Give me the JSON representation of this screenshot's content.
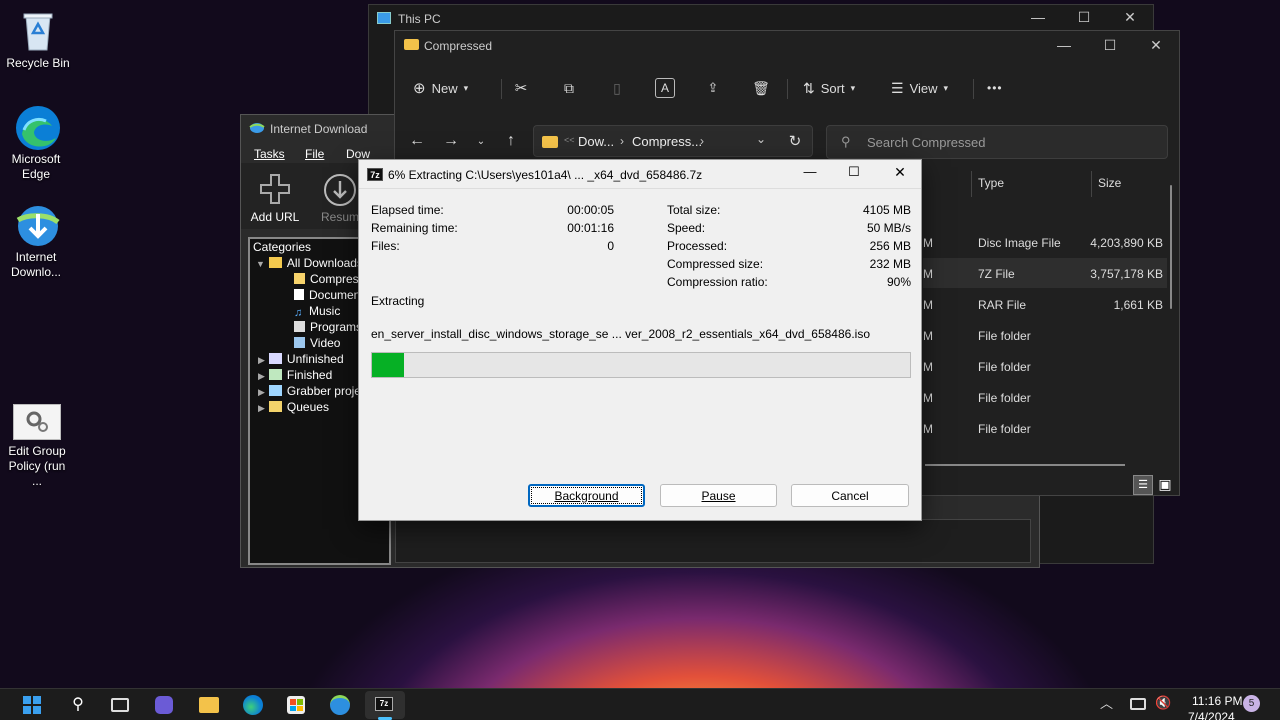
{
  "desktop": {
    "icons": [
      {
        "label": "Recycle Bin"
      },
      {
        "label": "Microsoft Edge"
      },
      {
        "label": "Internet Downlo..."
      },
      {
        "label": "Edit Group Policy (run ..."
      }
    ]
  },
  "thispc": {
    "title": "This PC"
  },
  "explorer": {
    "title": "Compressed",
    "toolbar": {
      "new": "New",
      "sort": "Sort",
      "view": "View",
      "more": "•••"
    },
    "breadcrumb": {
      "sep0": "<<",
      "part1": "Dow...",
      "part2": "Compress..."
    },
    "search_placeholder": "Search Compressed",
    "columns": {
      "type": "Type",
      "size": "Size"
    },
    "rows": [
      {
        "date_tail": "M",
        "type": "Disc Image File",
        "size": "4,203,890 KB"
      },
      {
        "date_tail": "M",
        "type": "7Z File",
        "size": "3,757,178 KB"
      },
      {
        "date_tail": "M",
        "type": "RAR File",
        "size": "1,661 KB"
      },
      {
        "date_tail": "M",
        "type": "File folder",
        "size": ""
      },
      {
        "date_tail": "M",
        "type": "File folder",
        "size": ""
      },
      {
        "date_tail": "M",
        "type": "File folder",
        "size": ""
      },
      {
        "date_tail": "M",
        "type": "File folder",
        "size": ""
      }
    ]
  },
  "idm": {
    "title": "Internet Download",
    "menu": {
      "tasks": "Tasks",
      "file": "File",
      "downloads": "Dow"
    },
    "toolbar": {
      "add_url": "Add URL",
      "resume": "Resum"
    },
    "categories_label": "Categories",
    "tree": {
      "all": "All Downloads",
      "compressed": "Compress",
      "documents": "Document",
      "music": "Music",
      "programs": "Programs",
      "video": "Video",
      "unfinished": "Unfinished",
      "finished": "Finished",
      "grabber": "Grabber proje",
      "queues": "Queues"
    }
  },
  "sevenzip": {
    "title": "6% Extracting C:\\Users\\yes101a4\\ ... _x64_dvd_658486.7z",
    "app_icon": "7z",
    "left": [
      {
        "label": "Elapsed time:",
        "value": "00:00:05"
      },
      {
        "label": "Remaining time:",
        "value": "00:01:16"
      },
      {
        "label": "Files:",
        "value": "0"
      }
    ],
    "right": [
      {
        "label": "Total size:",
        "value": "4105 MB"
      },
      {
        "label": "Speed:",
        "value": "50 MB/s"
      },
      {
        "label": "Processed:",
        "value": "256 MB"
      },
      {
        "label": "Compressed size:",
        "value": "232 MB"
      },
      {
        "label": "Compression ratio:",
        "value": "90%"
      }
    ],
    "status": "Extracting",
    "current_file": "en_server_install_disc_windows_storage_se ... ver_2008_r2_essentials_x64_dvd_658486.iso",
    "progress": 0.06,
    "progress_color": "#06b025",
    "buttons": {
      "background": "Background",
      "pause": "Pause",
      "cancel": "Cancel"
    }
  },
  "taskbar": {
    "time": "11:16 PM",
    "date": "7/4/2024",
    "badge": "5"
  }
}
